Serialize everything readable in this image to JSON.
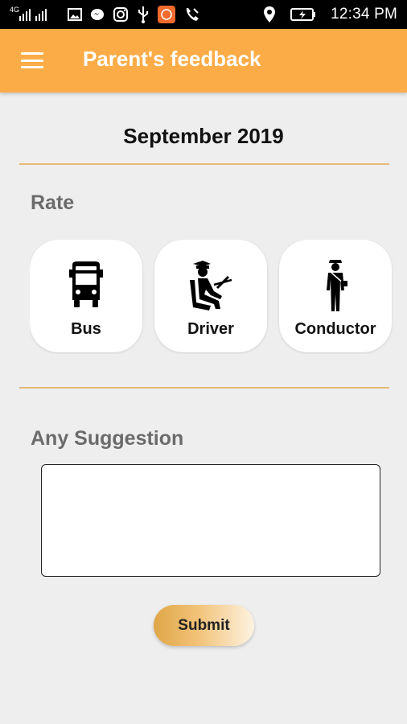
{
  "status_bar": {
    "network": "4G",
    "time": "12:34 PM",
    "icons": [
      "signal-icon",
      "image-icon",
      "messenger-icon",
      "instagram-icon",
      "usb-icon",
      "app-notification-icon",
      "call-icon",
      "location-icon",
      "battery-charging-icon"
    ]
  },
  "app_bar": {
    "title": "Parent's feedback",
    "menu_icon": "hamburger-menu-icon"
  },
  "month": "September 2019",
  "rate": {
    "label": "Rate",
    "items": [
      {
        "label": "Bus",
        "icon": "bus-icon"
      },
      {
        "label": "Driver",
        "icon": "driver-icon"
      },
      {
        "label": "Conductor",
        "icon": "conductor-icon"
      }
    ]
  },
  "suggestion": {
    "label": "Any Suggestion",
    "value": "",
    "placeholder": ""
  },
  "submit_label": "Submit",
  "colors": {
    "app_bar": "#fcac47",
    "divider": "#e7b978",
    "background": "#eeeeee"
  }
}
